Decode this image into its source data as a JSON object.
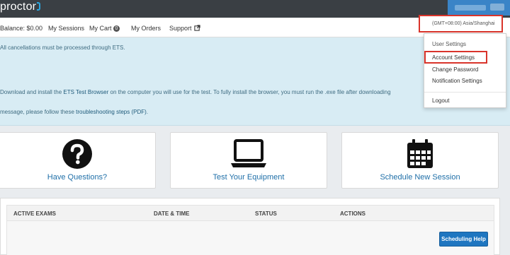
{
  "header": {
    "logo_text": "proctor",
    "brand_color": "#2aa7e0"
  },
  "nav": {
    "balance": "Balance: $0.00",
    "sessions": "My Sessions",
    "cart": "My Cart",
    "cart_count": "0",
    "orders": "My Orders",
    "support": "Support",
    "timezone": "(GMT+08:00) Asia/Shanghai"
  },
  "info": {
    "line1": "All cancellations must be processed through ETS.",
    "line2_pre": "Download and install the ",
    "line2_link": "ETS Test Browser",
    "line2_post": " on the computer you will use for the test. To fully install the browser, you must run the .exe file after downloading",
    "line3_pre": "message, please follow these ",
    "line3_link": "troubleshooting steps (PDF)",
    "line3_post": "."
  },
  "cards": [
    {
      "label": "Have Questions?",
      "icon": "question-circle-icon"
    },
    {
      "label": "Test Your Equipment",
      "icon": "laptop-icon"
    },
    {
      "label": "Schedule New Session",
      "icon": "calendar-icon"
    }
  ],
  "exams": {
    "headers": [
      "ACTIVE EXAMS",
      "DATE & TIME",
      "STATUS",
      "ACTIONS"
    ],
    "scheduling_help": "Scheduling Help"
  },
  "dropdown": {
    "header": "User Settings",
    "items": [
      "Account Settings",
      "Change Password",
      "Notification Settings"
    ],
    "logout": "Logout"
  },
  "colors": {
    "topbar": "#3a3f44",
    "info_bg": "#d8ecf4",
    "link": "#1f6fa8",
    "button": "#1f76c0",
    "highlight": "#d9342b"
  }
}
